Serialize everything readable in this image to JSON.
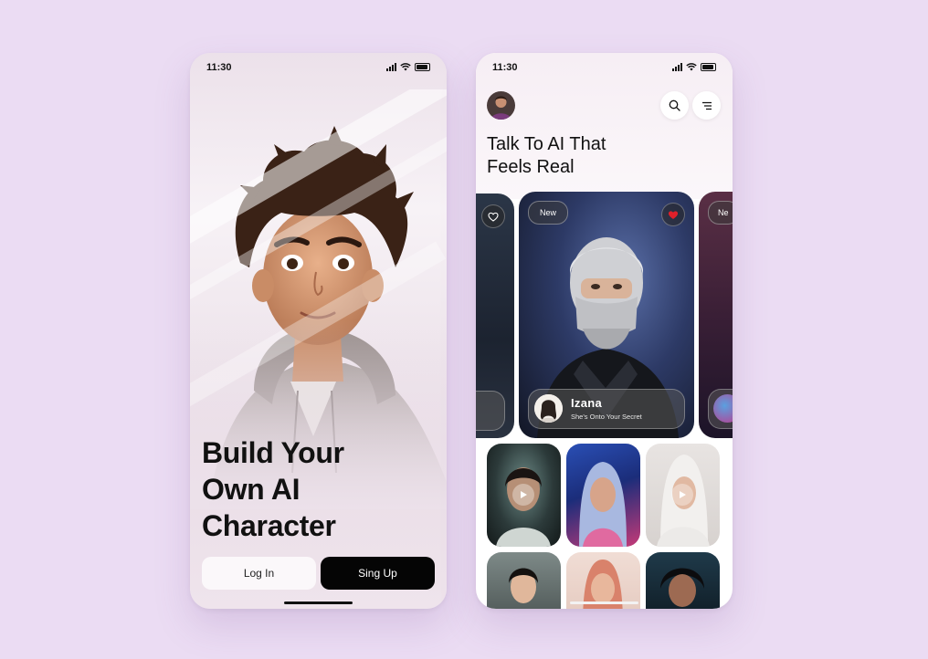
{
  "status_bar": {
    "time": "11:30"
  },
  "onboarding": {
    "title_lines": [
      "Build Your",
      "Own AI",
      "Character"
    ],
    "login_label": "Log In",
    "signup_label": "Sing Up"
  },
  "feed": {
    "title_lines": [
      "Talk To AI That",
      "Feels Real"
    ],
    "featured": {
      "badge": "New",
      "name": "Izana",
      "tagline": "She's Onto Your Secret",
      "liked": true
    },
    "side_card_badge": "Ne"
  },
  "icons": {
    "search": "search-icon",
    "menu": "menu-icon",
    "heart": "heart-icon",
    "play": "play-icon"
  },
  "colors": {
    "background": "#ebdcf3",
    "primary_button": "#050505",
    "heart_active": "#e0202a"
  }
}
